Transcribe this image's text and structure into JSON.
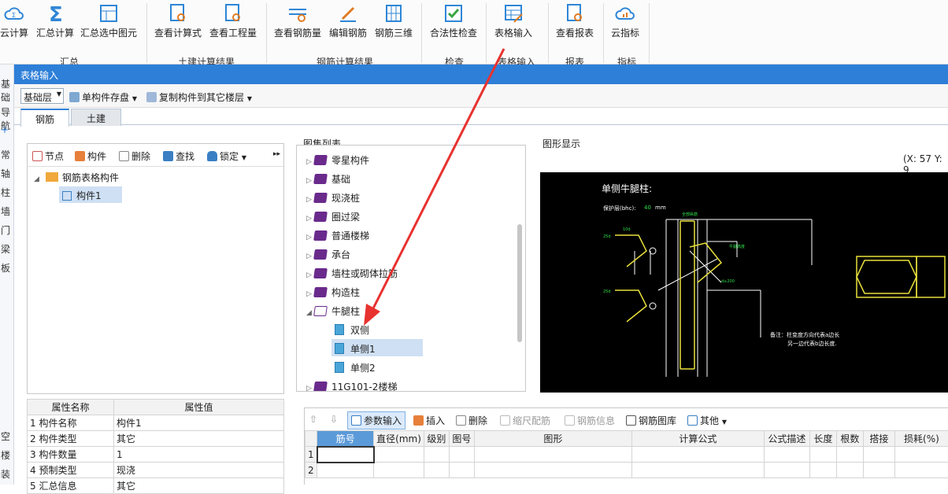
{
  "ribbon": {
    "buttons": [
      "云计算",
      "汇总计算",
      "汇总选中图元",
      "查看计算式",
      "查看工程量",
      "查看钢筋量",
      "编辑钢筋",
      "钢筋三维",
      "合法性检查",
      "表格输入",
      "查看报表",
      "云指标"
    ],
    "groups": [
      "汇总",
      "土建计算结果",
      "钢筋计算结果",
      "检查",
      "表格输入",
      "报表",
      "指标"
    ]
  },
  "leftstrip": [
    "基础",
    "导航",
    "+",
    "常",
    "轴",
    "柱",
    "墙",
    "门",
    "梁",
    "板",
    "空",
    "楼",
    "装"
  ],
  "window": {
    "title": "表格输入"
  },
  "toolbar": {
    "floor": "基础层",
    "save": "单构件存盘",
    "copy": "复制构件到其它楼层"
  },
  "tabs": [
    "钢筋",
    "土建"
  ],
  "tree_panel": {
    "tools": [
      "节点",
      "构件",
      "删除",
      "查找",
      "锁定"
    ],
    "more": "▸▸",
    "root": "钢筋表格构件",
    "child": "构件1"
  },
  "atlas": {
    "title": "图集列表",
    "items": [
      "零星构件",
      "基础",
      "现浇桩",
      "圈过梁",
      "普通楼梯",
      "承台",
      "墙柱或砌体拉筋",
      "构造柱",
      "牛腿柱"
    ],
    "children": [
      "双侧",
      "单侧1",
      "单侧2"
    ],
    "last": "11G101-2楼梯"
  },
  "figure": {
    "title": "图形显示",
    "coords": "(X: 57 Y: 9",
    "drawing_title": "单侧牛腿柱:",
    "cover_label": "保护层(bhc):",
    "cover_value": "40",
    "cover_unit": "mm",
    "note1": "备注：柱变度方向代表a边长",
    "note2": "另一边代表b边长度."
  },
  "props": {
    "headers": [
      "属性名称",
      "属性值"
    ],
    "rows": [
      [
        "1",
        "构件名称",
        "构件1"
      ],
      [
        "2",
        "构件类型",
        "其它"
      ],
      [
        "3",
        "构件数量",
        "1"
      ],
      [
        "4",
        "预制类型",
        "现浇"
      ],
      [
        "5",
        "汇总信息",
        "其它"
      ]
    ]
  },
  "rebar": {
    "tools": [
      "参数输入",
      "插入",
      "删除",
      "缩尺配筋",
      "钢筋信息",
      "钢筋图库",
      "其他"
    ],
    "columns": [
      "筋号",
      "直径(mm)",
      "级别",
      "图号",
      "图形",
      "计算公式",
      "公式描述",
      "长度",
      "根数",
      "搭接",
      "损耗(%)"
    ],
    "rows": [
      "1",
      "2"
    ]
  },
  "colors": {
    "accent": "#2e7fd8",
    "arrow": "#e8322f"
  }
}
